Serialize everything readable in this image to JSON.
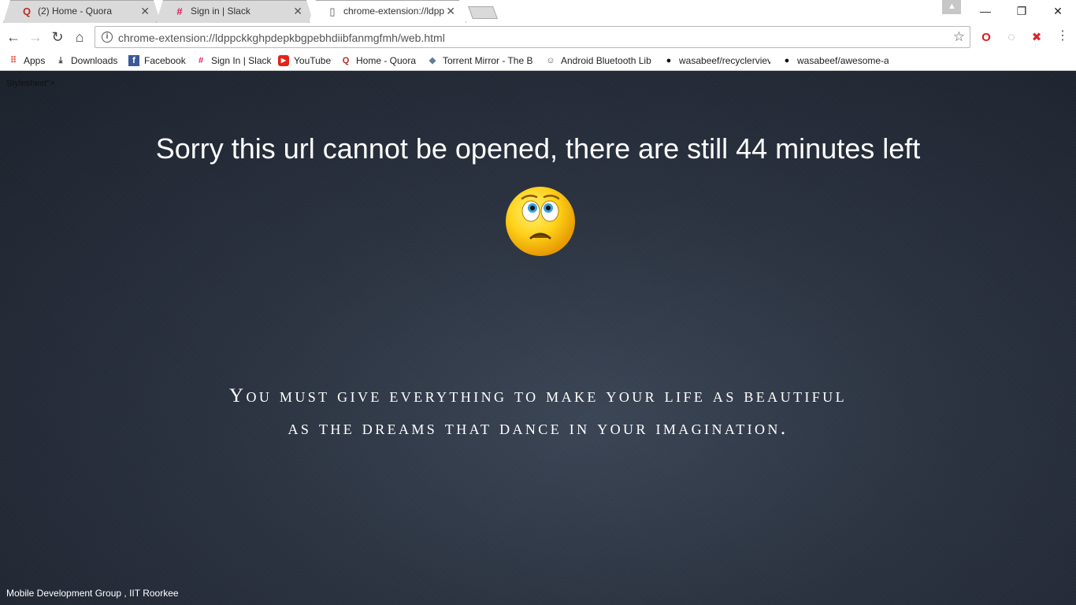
{
  "tabs": [
    {
      "title": "(2) Home - Quora",
      "icon": "quora-icon",
      "glyph": "Q",
      "color": "#b92b27",
      "active": false
    },
    {
      "title": "Sign in | Slack",
      "icon": "slack-icon",
      "glyph": "#",
      "color": "#e01e5a",
      "active": false
    },
    {
      "title": "chrome-extension://ldpp",
      "icon": "page-icon",
      "glyph": "▯",
      "color": "#555555",
      "active": true
    }
  ],
  "window": {
    "minimize": "—",
    "restore": "❐",
    "close": "✕",
    "profile": "▲"
  },
  "toolbar": {
    "back": "←",
    "forward": "→",
    "reload": "↻",
    "home": "⌂",
    "url": "chrome-extension://ldppckkghpdepkbgpebhdiibfanmgfmh/web.html",
    "info": "i",
    "star": "☆",
    "menu": "⋮",
    "extensions": [
      {
        "name": "opera-icon",
        "glyph": "O",
        "color": "#e0171f"
      },
      {
        "name": "timer-extension-icon",
        "glyph": "◌",
        "color": "#9a9a9a"
      },
      {
        "name": "block-extension-icon",
        "glyph": "✖",
        "color": "#d8262e"
      }
    ]
  },
  "bookmarks": [
    {
      "label": "Apps",
      "icon": "apps-grid-icon",
      "glyph": "⠿",
      "color": "#e55039"
    },
    {
      "label": "Downloads",
      "icon": "download-icon",
      "glyph": "⤓",
      "color": "#333333"
    },
    {
      "label": "Facebook",
      "icon": "facebook-icon",
      "glyph": "f",
      "color": "#3b5998"
    },
    {
      "label": "Sign In | Slack",
      "icon": "slack-icon",
      "glyph": "#",
      "color": "#e01e5a"
    },
    {
      "label": "YouTube",
      "icon": "youtube-icon",
      "glyph": "▶",
      "color": "#e62117"
    },
    {
      "label": "Home - Quora",
      "icon": "quora-icon",
      "glyph": "Q",
      "color": "#b92b27"
    },
    {
      "label": "Torrent Mirror - The B",
      "icon": "torrent-icon",
      "glyph": "◆",
      "color": "#5d7d9a"
    },
    {
      "label": "Android Bluetooth Lib",
      "icon": "android-icon",
      "glyph": "☺",
      "color": "#555555"
    },
    {
      "label": "wasabeef/recyclerviev",
      "icon": "github-icon",
      "glyph": "●",
      "color": "#111111"
    },
    {
      "label": "wasabeef/awesome-a",
      "icon": "github-icon",
      "glyph": "●",
      "color": "#111111"
    }
  ],
  "page": {
    "stray_text": "Stylesheet\">",
    "headline": "Sorry this url cannot be opened, there are still 44 minutes left",
    "quote_line1": "You must give everything to make your life as beautiful",
    "quote_line2": "as the dreams that dance in your imagination.",
    "footer": "Mobile Development Group , IIT Roorkee"
  }
}
